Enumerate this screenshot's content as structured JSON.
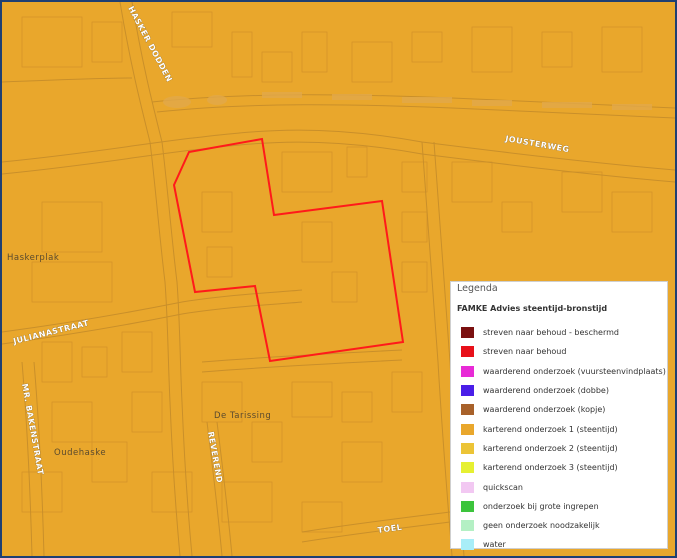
{
  "map": {
    "street_labels": {
      "hasker_dodden": "HASKER DODDEN",
      "jousterweg": "JOUSTERWEG",
      "julianastraat": "JULIANASTRAAT",
      "mr_bakenstraat": "MR. BAKENSTRAAT",
      "reverend": "REVEREND",
      "toel": "TOEL"
    },
    "place_labels": {
      "haskerplak": "Haskerplak",
      "oudehaske": "Oudehaske",
      "de_tarissing": "De Tarissing"
    },
    "colors": {
      "background": "#e9a72c",
      "selection_outline": "#ff1a1a",
      "frame": "#1f3f73"
    }
  },
  "legend": {
    "title": "Legenda",
    "subtitle": "FAMKE Advies steentijd-bronstijd",
    "items": [
      {
        "label": "streven naar behoud - beschermd",
        "color": "#7a1010"
      },
      {
        "label": "streven naar behoud",
        "color": "#e8101a"
      },
      {
        "label": "waarderend onderzoek (vuursteenvindplaats)",
        "color": "#e82ad6"
      },
      {
        "label": "waarderend onderzoek (dobbe)",
        "color": "#4a1ee8"
      },
      {
        "label": "waarderend onderzoek (kopje)",
        "color": "#a8612a"
      },
      {
        "label": "karterend onderzoek 1 (steentijd)",
        "color": "#e9a72c"
      },
      {
        "label": "karterend onderzoek 2 (steentijd)",
        "color": "#ecc436"
      },
      {
        "label": "karterend onderzoek 3 (steentijd)",
        "color": "#e6f032"
      },
      {
        "label": "quickscan",
        "color": "#f2c8f2"
      },
      {
        "label": "onderzoek bij grote ingrepen",
        "color": "#3cc43c"
      },
      {
        "label": "geen onderzoek noodzakelijk",
        "color": "#b4f0c4"
      },
      {
        "label": "water",
        "color": "#a8eef8"
      }
    ]
  }
}
